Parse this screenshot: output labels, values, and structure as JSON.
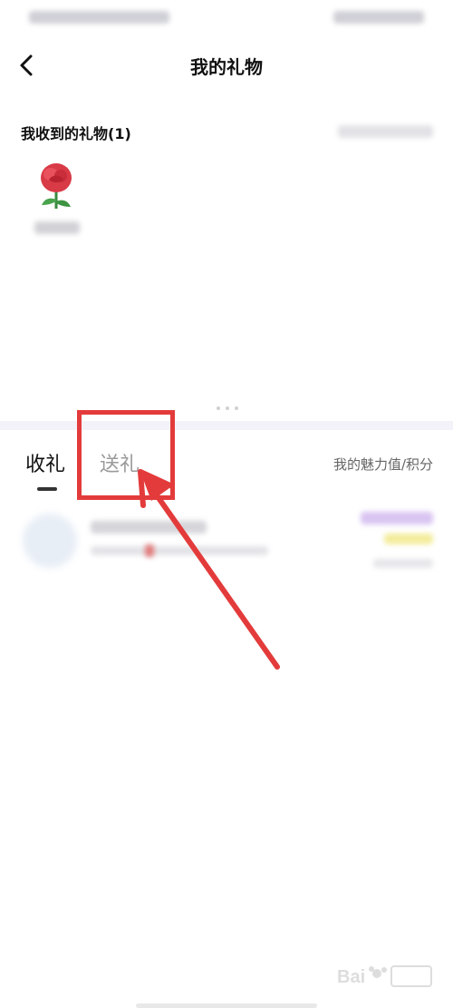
{
  "header": {
    "title": "我的礼物"
  },
  "received": {
    "header": "我收到的礼物(1)"
  },
  "tabs": {
    "receive": "收礼",
    "send": "送礼",
    "active": "receive"
  },
  "charm_link": "我的魅力值/积分",
  "colors": {
    "annotation_red": "#e33b3b",
    "divider": "#f3f2f8"
  }
}
